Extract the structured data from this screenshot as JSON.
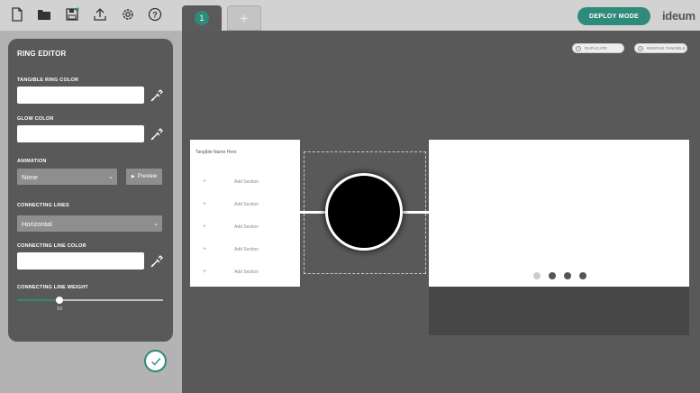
{
  "toolbar": {
    "icons": [
      "new-file-icon",
      "open-folder-icon",
      "save-icon",
      "upload-icon",
      "settings-icon",
      "help-icon"
    ]
  },
  "tabs": [
    {
      "label": "1",
      "active": true
    },
    {
      "label": "+",
      "active": false
    }
  ],
  "header": {
    "deploy_label": "DEPLOY MODE",
    "logo": "ideum"
  },
  "ring_editor": {
    "title": "RING EDITOR",
    "tangible_ring_color_label": "TANGIBLE RING COLOR",
    "glow_color_label": "GLOW COLOR",
    "animation_label": "ANIMATION",
    "animation_value": "None",
    "preview_label": "Preview",
    "connecting_lines_label": "CONNECTING LINES",
    "connecting_lines_value": "Horizontal",
    "connecting_line_color_label": "CONNECTING LINE COLOR",
    "connecting_line_weight_label": "CONNECTING LINE WEIGHT",
    "connecting_line_weight_value": "10",
    "connecting_line_weight_fraction": 0.29
  },
  "canvas": {
    "duplicate_label": "DUPLICATE",
    "remove_label": "REMOVE TANGIBLE",
    "tangible_name": "Tangible Name Here",
    "sections": [
      "Add Section",
      "Add Section",
      "Add Section",
      "Add Section",
      "Add Section"
    ],
    "pagination_count": 4,
    "pagination_active": 0
  },
  "colors": {
    "accent": "#2e8a7a",
    "panel": "#595959",
    "topbar": "#d2d2d2"
  }
}
